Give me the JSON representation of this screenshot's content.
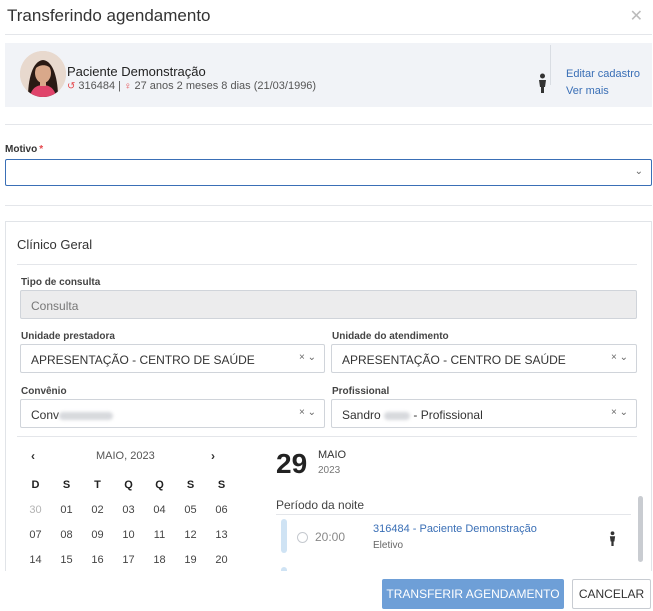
{
  "dialog": {
    "title": "Transferindo agendamento",
    "close_icon": "close-icon",
    "close_glyph": "✕"
  },
  "patient": {
    "name": "Paciente Demonstração",
    "record_icon": "history-icon",
    "record": "316484",
    "separator": "|",
    "gender_icon": "female-icon",
    "age": "27 anos 2 meses 8 dias (21/03/1996)",
    "edit_link": "Editar cadastro",
    "more_link": "Ver mais"
  },
  "form": {
    "motivo_label": "Motivo",
    "required_mark": "*",
    "motivo_value": ""
  },
  "panel": {
    "title": "Clínico Geral",
    "tipo_label": "Tipo de consulta",
    "tipo_value": "Consulta",
    "unidade_prestadora_label": "Unidade prestadora",
    "unidade_prestadora_value": "APRESENTAÇÃO - CENTRO DE SAÚDE",
    "unidade_atendimento_label": "Unidade do atendimento",
    "unidade_atendimento_value": "APRESENTAÇÃO - CENTRO DE SAÚDE",
    "convenio_label": "Convênio",
    "convenio_value": "Conv",
    "profissional_label": "Profissional",
    "profissional_prefix": "Sandro",
    "profissional_suffix": "- Profissional"
  },
  "calendar": {
    "prev": "‹",
    "next": "›",
    "month_label": "MAIO, 2023",
    "weekdays": [
      "D",
      "S",
      "T",
      "Q",
      "Q",
      "S",
      "S"
    ],
    "weeks": [
      [
        "30",
        "01",
        "02",
        "03",
        "04",
        "05",
        "06"
      ],
      [
        "07",
        "08",
        "09",
        "10",
        "11",
        "12",
        "13"
      ],
      [
        "14",
        "15",
        "16",
        "17",
        "18",
        "19",
        "20"
      ]
    ]
  },
  "day": {
    "number": "29",
    "month": "MAIO",
    "year": "2023",
    "period": "Período da noite"
  },
  "slot": {
    "time": "20:00",
    "patient": "316484 - Paciente Demonstração",
    "type": "Eletivo"
  },
  "actions": {
    "transfer": "TRANSFERIR AGENDAMENTO",
    "cancel": "CANCELAR"
  },
  "colors": {
    "accent": "#3a6fb6",
    "primary_button": "#6e9fd7",
    "required": "#e5484d"
  }
}
